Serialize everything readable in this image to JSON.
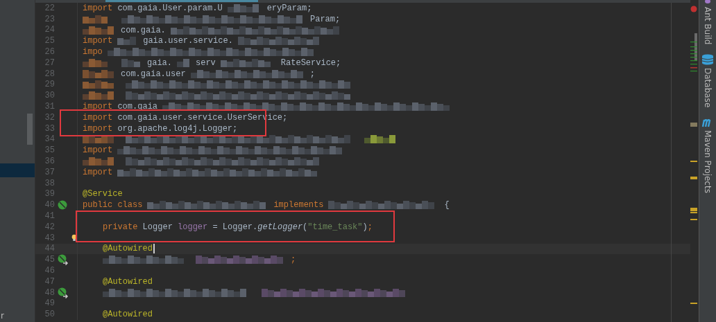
{
  "left_panel": {
    "text": "r"
  },
  "editor": {
    "lines": [
      {
        "number": "22",
        "current": false,
        "indent": false,
        "segments": [
          {
            "kind": "keyword",
            "text": "import"
          },
          {
            "kind": "plain",
            "text": " com.gaia.User.param.U"
          },
          {
            "kind": "blurred"
          },
          {
            "kind": "plain",
            "text": "eryParam;"
          }
        ]
      },
      {
        "number": "23",
        "current": false,
        "indent": false,
        "segments": [
          {
            "kind": "blurred"
          },
          {
            "kind": "blurred"
          },
          {
            "kind": "plain",
            "text": "Param;"
          }
        ]
      },
      {
        "number": "24",
        "current": false,
        "indent": false,
        "segments": [
          {
            "kind": "blurred"
          },
          {
            "kind": "plain",
            "text": "com.gaia."
          },
          {
            "kind": "blurred"
          }
        ]
      },
      {
        "number": "25",
        "current": false,
        "indent": false,
        "segments": [
          {
            "kind": "keyword",
            "text": "import"
          },
          {
            "kind": "blurred"
          },
          {
            "kind": "plain",
            "text": "gaia.user.service."
          },
          {
            "kind": "blurred"
          }
        ]
      },
      {
        "number": "26",
        "current": false,
        "indent": false,
        "segments": [
          {
            "kind": "keyword",
            "text": "impo"
          },
          {
            "kind": "blurred"
          }
        ]
      },
      {
        "number": "27",
        "current": false,
        "indent": false,
        "segments": [
          {
            "kind": "blurred"
          },
          {
            "kind": "blurred"
          },
          {
            "kind": "plain",
            "text": "gaia."
          },
          {
            "kind": "blurred"
          },
          {
            "kind": "plain",
            "text": "serv"
          },
          {
            "kind": "blurred"
          },
          {
            "kind": "plain",
            "text": "RateService;"
          }
        ]
      },
      {
        "number": "28",
        "current": false,
        "indent": false,
        "segments": [
          {
            "kind": "blurred"
          },
          {
            "kind": "plain",
            "text": "com.gaia.user"
          },
          {
            "kind": "blurred"
          },
          {
            "kind": "plain",
            "text": ";"
          }
        ]
      },
      {
        "number": "29",
        "current": false,
        "indent": false,
        "segments": [
          {
            "kind": "blurred"
          },
          {
            "kind": "blurred"
          }
        ]
      },
      {
        "number": "30",
        "current": false,
        "indent": false,
        "segments": [
          {
            "kind": "blurred"
          },
          {
            "kind": "blurred"
          }
        ]
      },
      {
        "number": "31",
        "current": false,
        "indent": false,
        "segments": [
          {
            "kind": "keyword",
            "text": "import"
          },
          {
            "kind": "plain",
            "text": " com.gaia"
          },
          {
            "kind": "blurred"
          }
        ]
      },
      {
        "number": "32",
        "current": false,
        "indent": false,
        "segments": [
          {
            "kind": "keyword",
            "text": "import"
          },
          {
            "kind": "plain",
            "text": " com.gaia.user.service.UserService;"
          }
        ]
      },
      {
        "number": "33",
        "current": false,
        "indent": false,
        "segments": [
          {
            "kind": "keyword",
            "text": "import"
          },
          {
            "kind": "plain",
            "text": " org.apache.log4j.Logger;"
          }
        ]
      },
      {
        "number": "34",
        "current": false,
        "indent": false,
        "segments": [
          {
            "kind": "blurred"
          },
          {
            "kind": "blurred"
          },
          {
            "kind": "blurred"
          }
        ]
      },
      {
        "number": "35",
        "current": false,
        "indent": false,
        "segments": [
          {
            "kind": "keyword",
            "text": "import"
          },
          {
            "kind": "blurred"
          }
        ]
      },
      {
        "number": "36",
        "current": false,
        "indent": false,
        "segments": [
          {
            "kind": "blurred"
          },
          {
            "kind": "blurred"
          }
        ]
      },
      {
        "number": "37",
        "current": false,
        "indent": false,
        "segments": [
          {
            "kind": "keyword",
            "text": "import"
          },
          {
            "kind": "blurred"
          }
        ]
      },
      {
        "number": "38",
        "current": false,
        "indent": false
      },
      {
        "number": "39",
        "current": false,
        "indent": false,
        "segments": [
          {
            "kind": "annotation",
            "text": "@Service"
          }
        ]
      },
      {
        "number": "40",
        "current": false,
        "indent": false,
        "gutter": {
          "kind": "bean"
        },
        "segments": [
          {
            "kind": "keyword",
            "text": "public class"
          },
          {
            "kind": "blurred"
          },
          {
            "kind": "keyword",
            "text": "implements"
          },
          {
            "kind": "blurred"
          },
          {
            "kind": "plain",
            "text": "{"
          }
        ]
      },
      {
        "number": "41",
        "current": false,
        "indent": false
      },
      {
        "number": "42",
        "current": false,
        "indent": true,
        "segments": [
          {
            "kind": "keyword",
            "text": "private"
          },
          {
            "kind": "plain",
            "text": " Logger "
          },
          {
            "kind": "field",
            "text": "logger"
          },
          {
            "kind": "plain",
            "text": " = Logger."
          },
          {
            "kind": "method",
            "text": "getLogger"
          },
          {
            "kind": "plain",
            "text": "("
          },
          {
            "kind": "string",
            "text": "\"time_task\""
          },
          {
            "kind": "plain",
            "text": ")"
          },
          {
            "kind": "keyword",
            "text": ";"
          }
        ]
      },
      {
        "number": "43",
        "current": false,
        "indent": false,
        "gutter": {
          "kind": "bulb"
        }
      },
      {
        "number": "44",
        "current": true,
        "indent": true,
        "segments": [
          {
            "kind": "annotation",
            "text": "@Autowired"
          }
        ]
      },
      {
        "number": "45",
        "current": false,
        "indent": true,
        "gutter": {
          "kind": "inject"
        },
        "segments": [
          {
            "kind": "blurred"
          },
          {
            "kind": "blurred"
          },
          {
            "kind": "keyword",
            "text": ";"
          }
        ]
      },
      {
        "number": "46",
        "current": false,
        "indent": false
      },
      {
        "number": "47",
        "current": false,
        "indent": true,
        "segments": [
          {
            "kind": "annotation",
            "text": "@Autowired"
          }
        ]
      },
      {
        "number": "48",
        "current": false,
        "indent": true,
        "gutter": {
          "kind": "inject"
        },
        "segments": [
          {
            "kind": "blurred"
          },
          {
            "kind": "blurred"
          }
        ]
      },
      {
        "number": "49",
        "current": false,
        "indent": false
      },
      {
        "number": "50",
        "current": false,
        "indent": true,
        "segments": [
          {
            "kind": "annotation",
            "text": "@Autowired"
          }
        ]
      }
    ]
  },
  "tool_strip": [
    "Ant Build",
    "Database",
    "Maven Projects"
  ]
}
